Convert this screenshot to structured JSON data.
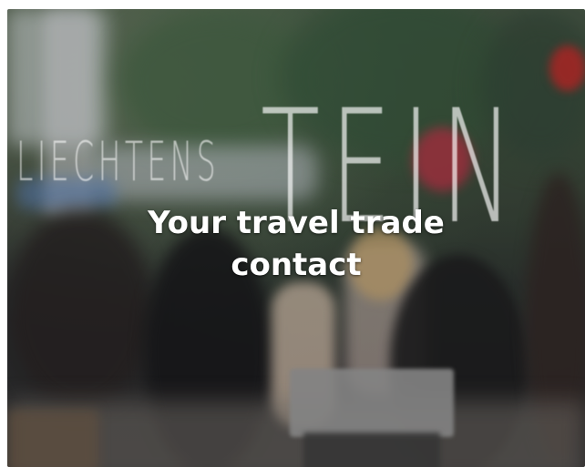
{
  "card": {
    "headline_line1": "Your travel trade",
    "headline_line2": "contact",
    "watermark_small": "LIECHTENS",
    "watermark_big": "TEIN"
  },
  "colors": {
    "background": "#ffffff",
    "headline_text": "#ffffff"
  }
}
